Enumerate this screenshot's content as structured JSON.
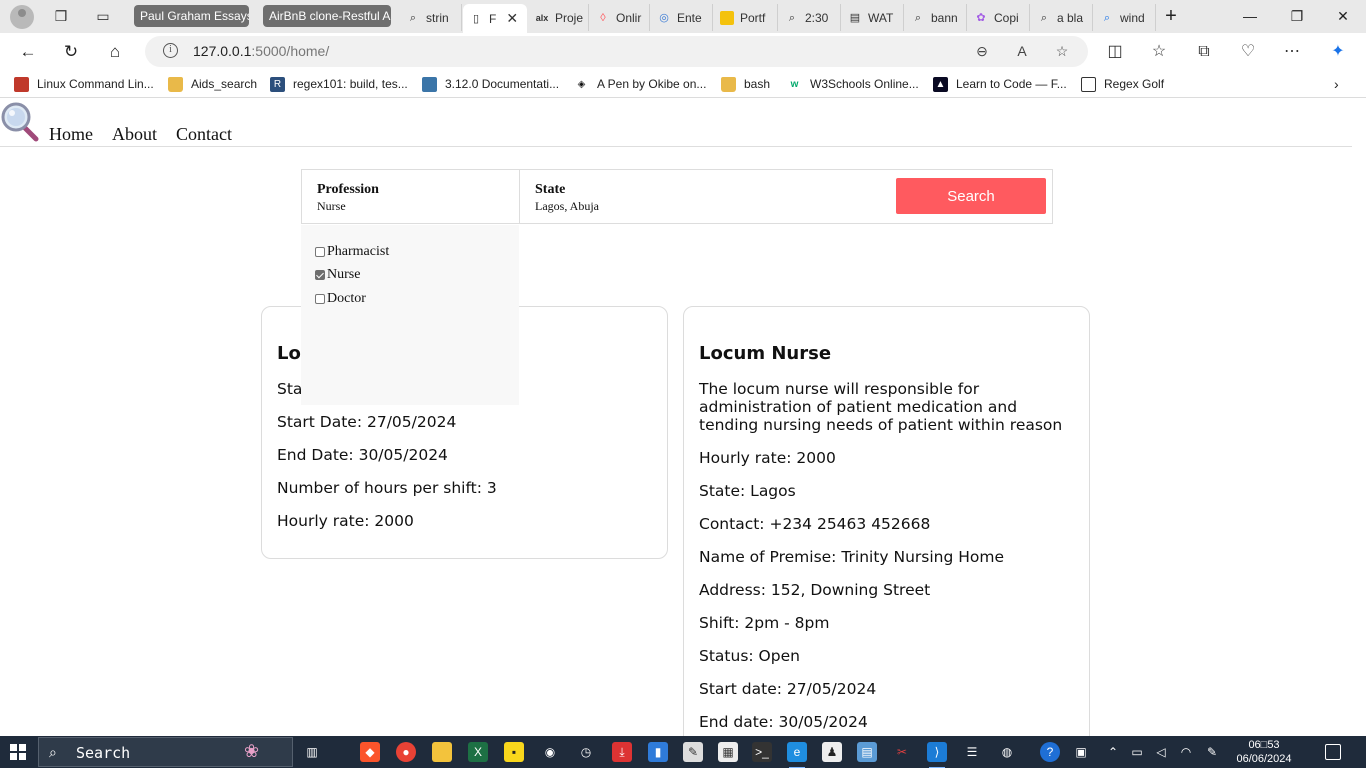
{
  "browser": {
    "tab_groups": [
      "Paul Graham Essays",
      "AirBnB clone-Restful A"
    ],
    "tabs": [
      {
        "label": "strin",
        "icon": "search-icon"
      },
      {
        "label": "F",
        "icon": "page-icon",
        "active": true
      },
      {
        "label": "Proje",
        "icon": "alx-icon"
      },
      {
        "label": "Onlir",
        "icon": "airbnb-icon"
      },
      {
        "label": "Ente",
        "icon": "globe-icon"
      },
      {
        "label": "Portf",
        "icon": "sticky-icon"
      },
      {
        "label": "2:30",
        "icon": "search-icon"
      },
      {
        "label": "WAT",
        "icon": "doc-icon"
      },
      {
        "label": "bann",
        "icon": "search-icon"
      },
      {
        "label": "Copi",
        "icon": "copilot-icon"
      },
      {
        "label": "a bla",
        "icon": "search-icon"
      },
      {
        "label": "wind",
        "icon": "search-icon"
      }
    ],
    "url_host": "127.0.0.1",
    "url_rest": ":5000/home/",
    "bookmarks": [
      "Linux Command Lin...",
      "Aids_search",
      "regex101: build, tes...",
      "3.12.0 Documentati...",
      "A Pen by Okibe on...",
      "bash",
      "W3Schools Online...",
      "Learn to Code — F...",
      "Regex Golf"
    ]
  },
  "site": {
    "nav": [
      "Home",
      "About",
      "Contact"
    ],
    "search": {
      "profession_label": "Profession",
      "profession_value": "Nurse",
      "state_label": "State",
      "state_value": "Lagos, Abuja",
      "button": "Search"
    },
    "profession_options": [
      {
        "label": "Pharmacist",
        "checked": false
      },
      {
        "label": "Nurse",
        "checked": true
      },
      {
        "label": "Doctor",
        "checked": false
      }
    ],
    "card_left": {
      "title": "Lo",
      "line_status_partial": "Sta",
      "start_date": "Start Date: 27/05/2024",
      "end_date": "End Date: 30/05/2024",
      "hours": "Number of hours per shift: 3",
      "rate": "Hourly rate: 2000"
    },
    "card_right": {
      "title": "Locum Nurse",
      "description": "The locum nurse will responsible for administration of patient medication and tending nursing needs of patient within reason",
      "rate": "Hourly rate: 2000",
      "state": "State: Lagos",
      "contact": "Contact: +234 25463 452668",
      "premise": "Name of Premise: Trinity Nursing Home",
      "address": "Address: 152, Downing Street",
      "shift": "Shift: 2pm - 8pm",
      "status": "Status: Open",
      "start_date": "Start date: 27/05/2024",
      "end_date": "End date: 30/05/2024"
    }
  },
  "taskbar": {
    "search_text": "Search",
    "time": "06□53",
    "date": "06/06/2024"
  },
  "colors": {
    "search_button": "#ff5a5f",
    "taskbar": "#1f2b3b"
  }
}
